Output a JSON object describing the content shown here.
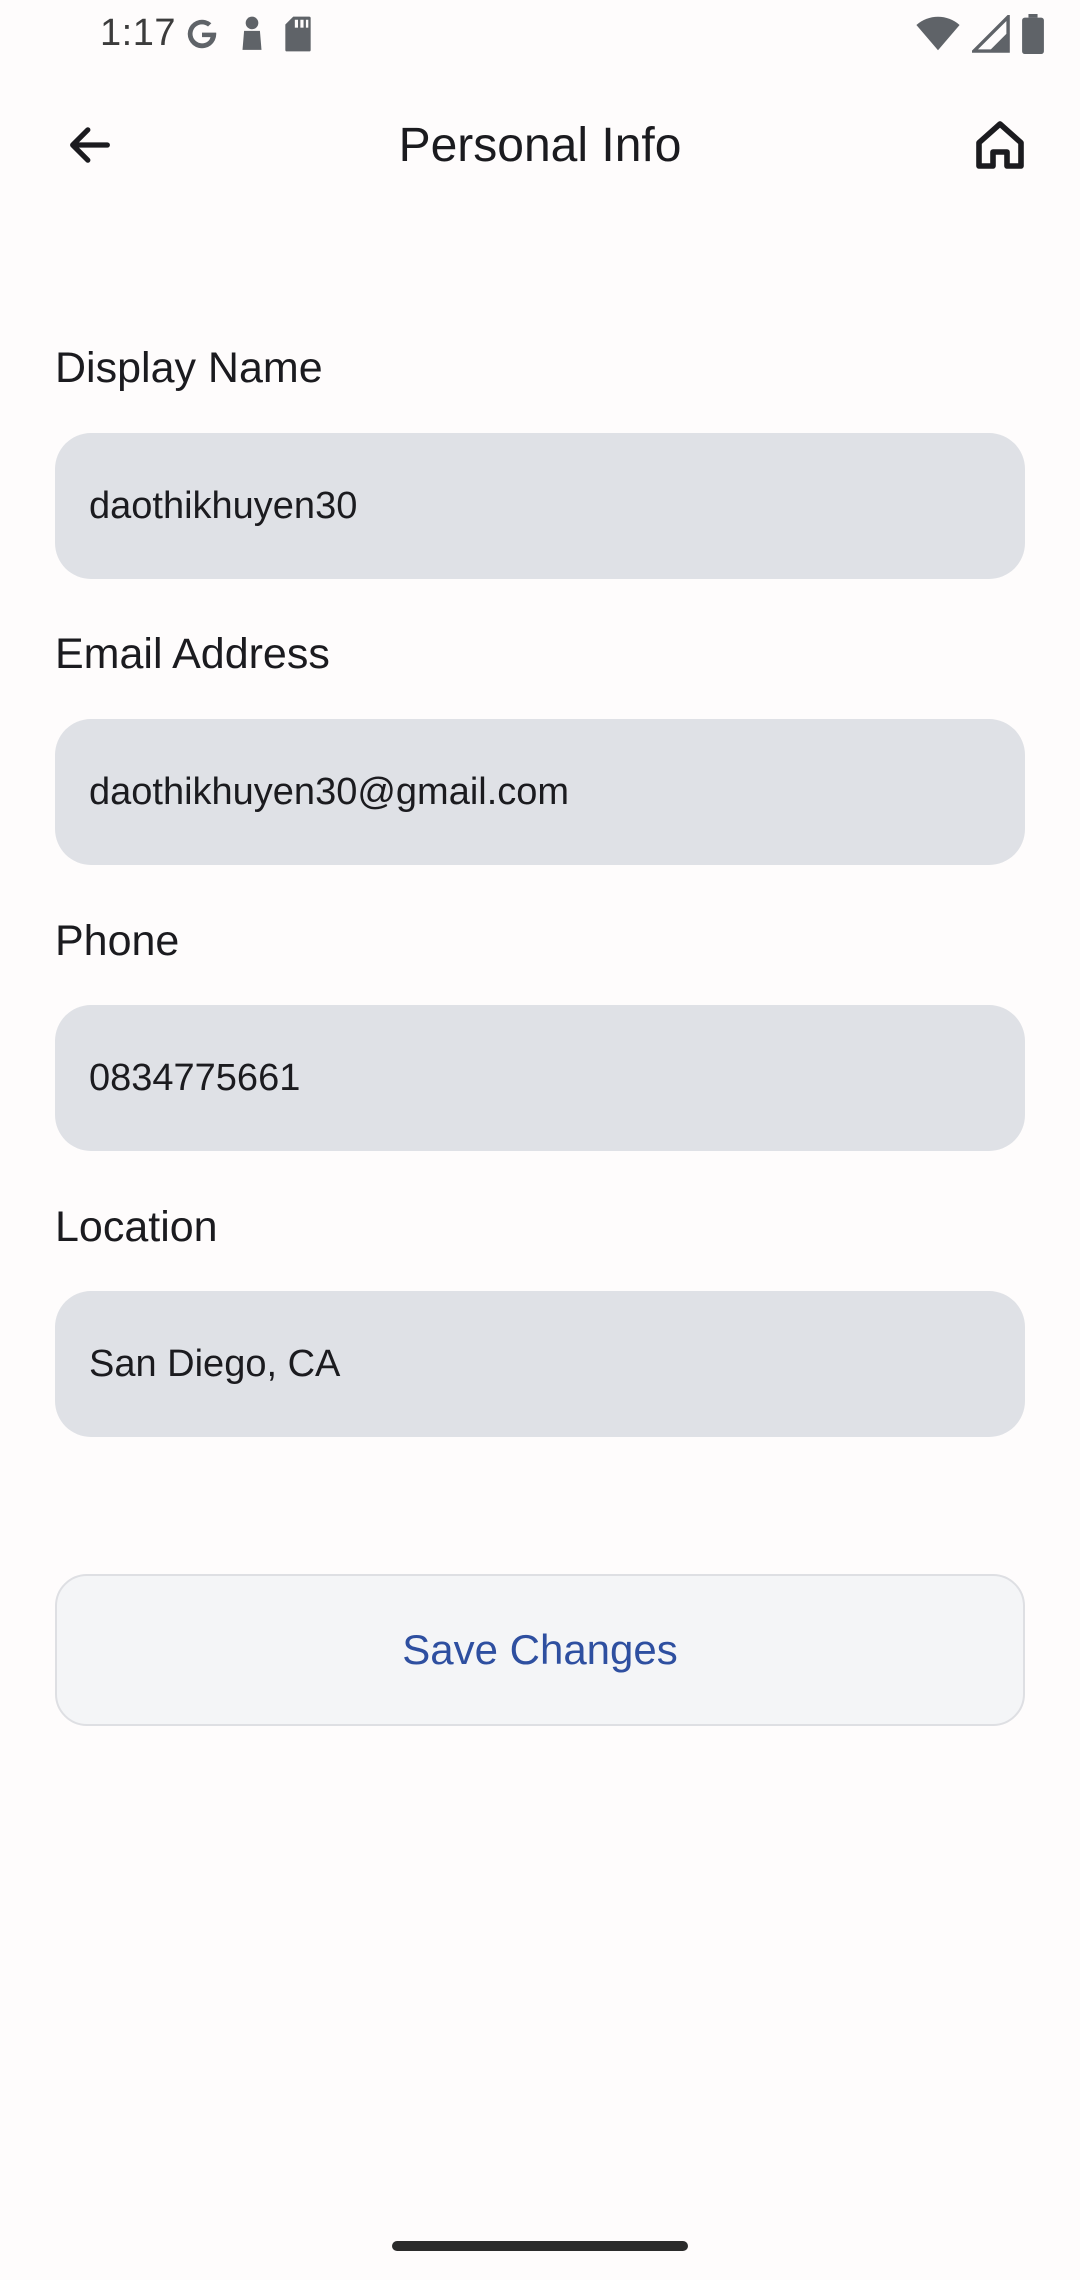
{
  "status_bar": {
    "time": "1:17",
    "left_icons": [
      "google-icon",
      "pin-icon",
      "sd-card-icon"
    ],
    "right_icons": [
      "wifi-icon",
      "signal-icon",
      "battery-icon"
    ]
  },
  "app_bar": {
    "title": "Personal Info",
    "back_icon": "arrow-back-icon",
    "home_icon": "home-icon"
  },
  "form": {
    "display_name": {
      "label": "Display Name",
      "value": "daothikhuyen30"
    },
    "email": {
      "label": "Email Address",
      "value": "daothikhuyen30@gmail.com"
    },
    "phone": {
      "label": "Phone",
      "value": "0834775661"
    },
    "location": {
      "label": "Location",
      "value": "San Diego, CA"
    }
  },
  "actions": {
    "save_label": "Save Changes"
  },
  "colors": {
    "background": "#fefcfc",
    "input_background": "#dfe1e6",
    "button_background": "#f4f5f7",
    "button_text": "#2e4fa0",
    "text": "#1b1b1f"
  }
}
